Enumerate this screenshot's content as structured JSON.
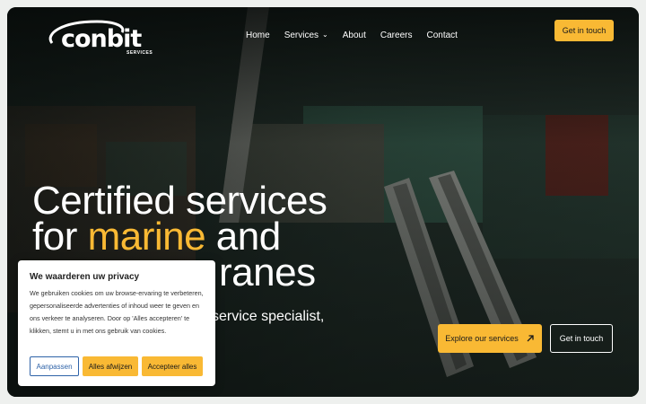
{
  "brand": {
    "name": "conbit",
    "sub": "SERVICES"
  },
  "nav": {
    "items": [
      {
        "label": "Home"
      },
      {
        "label": "Services",
        "has_dropdown": true
      },
      {
        "label": "About"
      },
      {
        "label": "Careers"
      },
      {
        "label": "Contact"
      }
    ],
    "cta": "Get in touch"
  },
  "hero": {
    "line1": "Certified services",
    "line2_pre": "for ",
    "line2_accent": "marine",
    "line2_post": " and",
    "line3": "ranes",
    "subline": "service specialist,",
    "primary_cta": "Explore our services",
    "secondary_cta": "Get in touch"
  },
  "cookie": {
    "title": "We waarderen uw privacy",
    "body": "We gebruiken cookies om uw browse-ervaring te verbeteren, gepersonaliseerde advertenties of inhoud weer te geven en ons verkeer te analyseren. Door op 'Alles accepteren' te klikken, stemt u in met ons gebruik van cookies.",
    "customize": "Aanpassen",
    "reject": "Alles afwijzen",
    "accept": "Accepteer alles"
  },
  "colors": {
    "accent": "#f9b934",
    "link_blue": "#2f63a8"
  },
  "icons": {
    "dropdown": "chevron-down-icon",
    "explore": "arrow-up-right-icon"
  }
}
